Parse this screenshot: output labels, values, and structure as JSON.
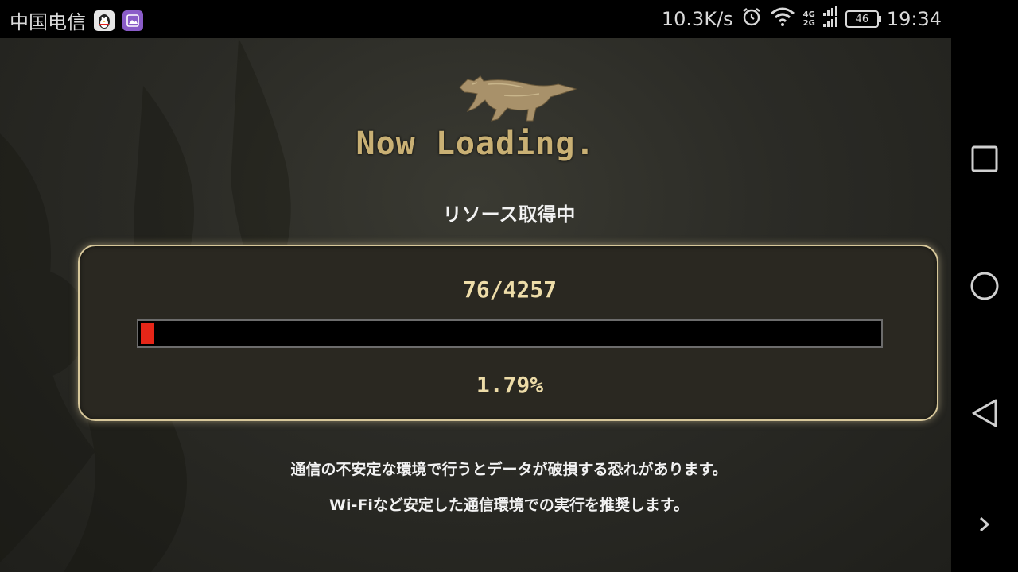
{
  "status_bar": {
    "carrier": "中国电信",
    "net_speed": "10.3K/s",
    "network_4g": "4G",
    "network_2g": "2G",
    "battery": "46",
    "time": "19:34"
  },
  "game": {
    "title": "Now Loading.",
    "status": "リソース取得中",
    "progress_count": "76/4257",
    "progress_percent": "1.79%",
    "progress_fraction": 0.0179,
    "warning_line1": "通信の不安定な環境で行うとデータが破損する恐れがあります。",
    "warning_line2": "Wi-Fiなど安定した通信環境での実行を推奨します。"
  },
  "colors": {
    "accent_gold": "#c9b074",
    "progress_red": "#e62618",
    "panel_border": "#d7c79a"
  },
  "nav_bar": {
    "icons": [
      "recent-apps-icon",
      "home-icon",
      "back-icon",
      "expand-icon"
    ]
  }
}
